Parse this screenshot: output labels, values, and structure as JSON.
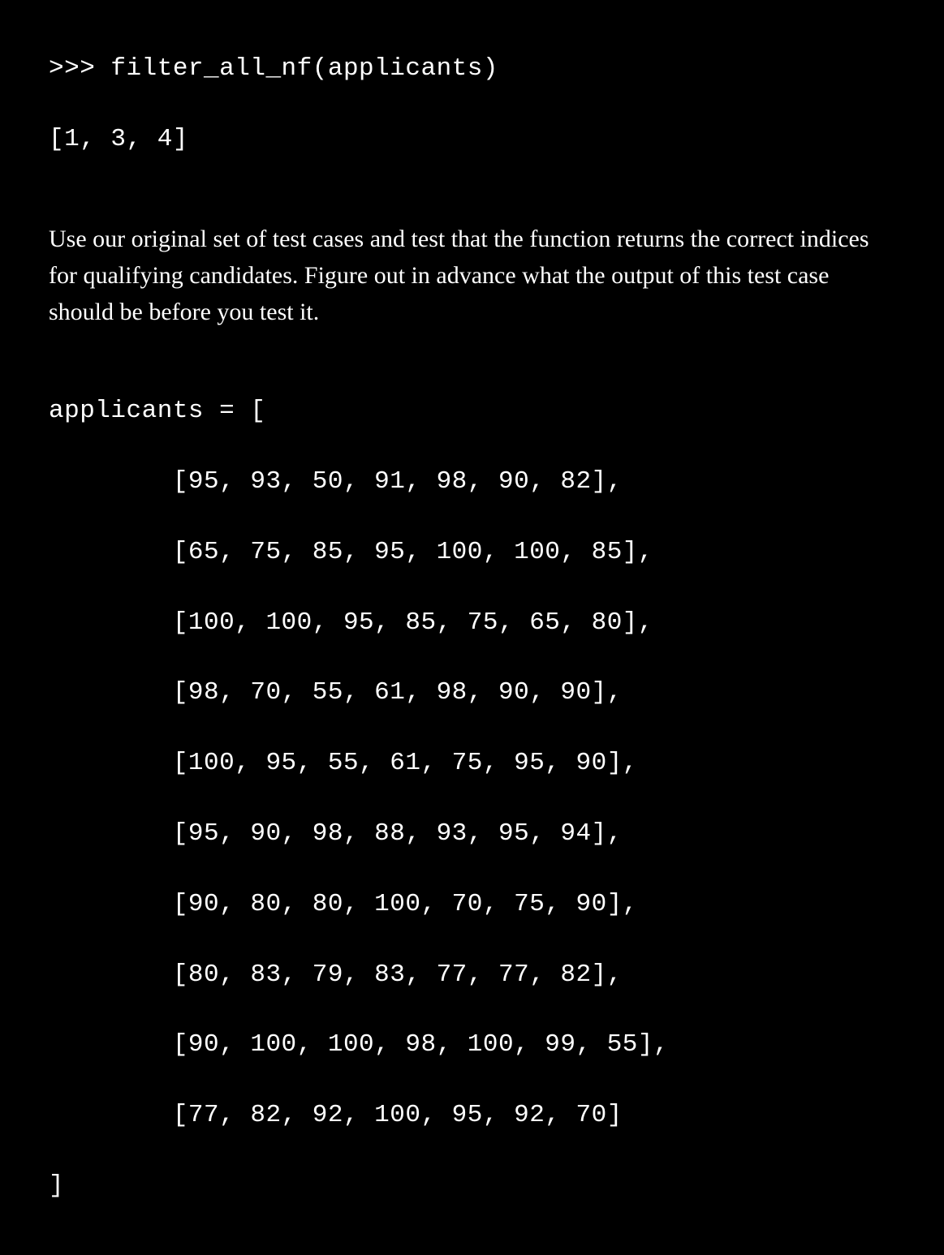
{
  "code_top": {
    "line1": ">>> filter_all_nf(applicants)",
    "line2": "[1, 3, 4]"
  },
  "prose": "Use our original set of test cases and test that the function returns the correct indices for qualifying candidates. Figure out in advance what the output of this test case should be before you test it.",
  "code_bottom": {
    "line0": "applicants = [",
    "line1": "        [95, 93, 50, 91, 98, 90, 82],",
    "line2": "        [65, 75, 85, 95, 100, 100, 85],",
    "line3": "        [100, 100, 95, 85, 75, 65, 80],",
    "line4": "        [98, 70, 55, 61, 98, 90, 90],",
    "line5": "        [100, 95, 55, 61, 75, 95, 90],",
    "line6": "        [95, 90, 98, 88, 93, 95, 94],",
    "line7": "        [90, 80, 80, 100, 70, 75, 90],",
    "line8": "        [80, 83, 79, 83, 77, 77, 82],",
    "line9": "        [90, 100, 100, 98, 100, 99, 55],",
    "line10": "        [77, 82, 92, 100, 95, 92, 70]",
    "line11": "]"
  }
}
